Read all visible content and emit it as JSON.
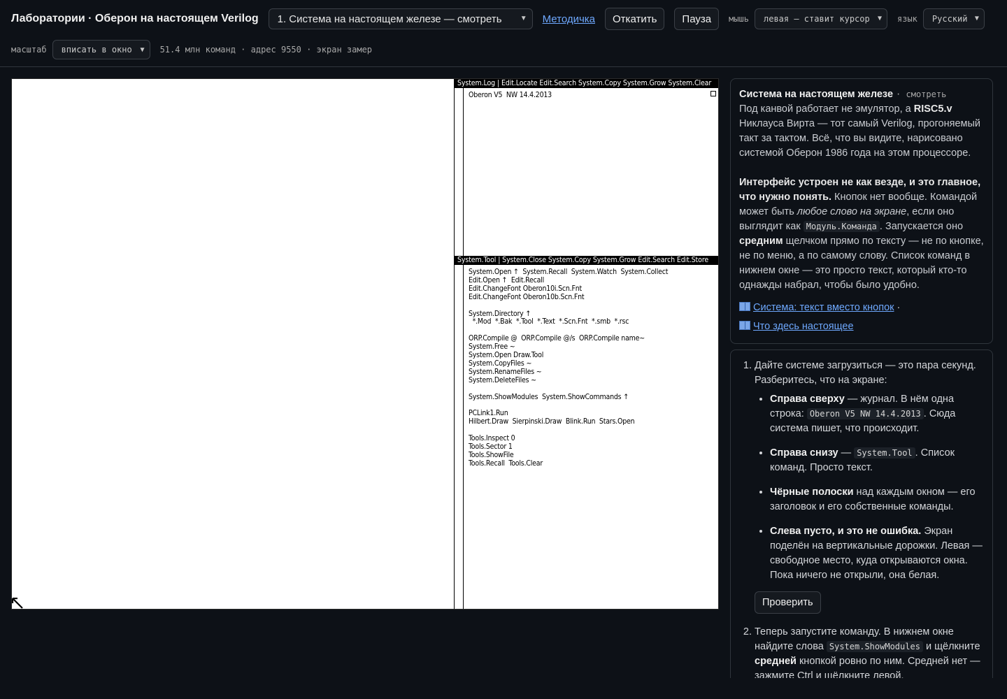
{
  "header": {
    "app_title": "Лаборатории · Оберон на настоящем Verilog",
    "lesson_select": "1. Система на настоящем железе — смотреть",
    "manual_link": "Методичка",
    "rollback_button": "Откатить",
    "pause_button": "Пауза",
    "mouse_label": "мышь",
    "mouse_select": "левая — ставит курсор",
    "lang_label": "язык",
    "lang_select": "Русский",
    "scale_label": "масштаб",
    "scale_select": "вписать в окно",
    "status": "51.4 млн команд · адрес 9550 · экран замер"
  },
  "screen": {
    "log_title": "System.Log | Edit.Locate Edit.Search System.Copy System.Grow System.Clear",
    "log_text": "Oberon V5  NW 14.4.2013",
    "tool_title": "System.Tool | System.Close System.Copy System.Grow Edit.Search Edit.Store",
    "tool_text": "System.Open ↑  System.Recall  System.Watch  System.Collect\nEdit.Open ↑  Edit.Recall\nEdit.ChangeFont Oberon10i.Scn.Fnt\nEdit.ChangeFont Oberon10b.Scn.Fnt\n\nSystem.Directory ↑\n  *.Mod  *.Bak  *.Tool  *.Text  *.Scn.Fnt  *.smb  *.rsc\n\nORP.Compile @  ORP.Compile @/s  ORP.Compile name~\nSystem.Free ~\nSystem.Open Draw.Tool\nSystem.CopyFiles ~\nSystem.RenameFiles ~\nSystem.DeleteFiles ~\n\nSystem.ShowModules  System.ShowCommands ↑\n\nPCLink1.Run\nHilbert.Draw  Sierpinski.Draw  Blink.Run  Stars.Open\n\nTools.Inspect 0\nTools.Sector 1\nTools.ShowFile\nTools.Recall  Tools.Clear"
  },
  "intro": {
    "heading": "Система на настоящем железе",
    "tag": "смотреть",
    "p1_a": "Под канвой работает не эмулятор, а ",
    "p1_b": "RISC5.v",
    "p1_c": " Никлауса Вирта — тот самый Verilog, прогоняемый такт за тактом. Всё, что вы видите, нарисовано системой Оберон 1986 года на этом процессоре.",
    "p2_bold": "Интерфейс устроен не как везде, и это главное, что нужно понять.",
    "p2_a": " Кнопок нет вообще. Командой может быть ",
    "p2_em": "любое слово на экране",
    "p2_b": ", если оно выглядит как ",
    "p2_code": "Модуль.Команда",
    "p2_c": ". Запускается оно ",
    "p2_bold2": "средним",
    "p2_d": " щелчком прямо по тексту — не по кнопке, не по меню, а по самому слову. Список команд в нижнем окне — это просто текст, который кто-то однажды набрал, чтобы было удобно.",
    "link1": "Система: текст вместо кнопок",
    "link_sep": " ·",
    "link2": "Что здесь настоящее"
  },
  "steps": {
    "s1_text": "Дайте системе загрузиться — это пара секунд. Разберитесь, что на экране:",
    "b1_bold": "Справа сверху",
    "b1_a": " — журнал. В нём одна строка: ",
    "b1_code": "Oberon V5 NW 14.4.2013",
    "b1_b": ". Сюда система пишет, что происходит.",
    "b2_bold": "Справа снизу",
    "b2_a": " — ",
    "b2_code": "System.Tool",
    "b2_b": ". Список команд. Просто текст.",
    "b3_bold": "Чёрные полоски",
    "b3_a": " над каждым окном — его заголовок и его собственные команды.",
    "b4_bold": "Слева пусто, и это не ошибка.",
    "b4_a": " Экран поделён на вертикальные дорожки. Левая — свободное место, куда открываются окна. Пока ничего не открыли, она белая.",
    "check_button": "Проверить",
    "s2_a": "Теперь запустите команду. В нижнем окне найдите слова ",
    "s2_code": "System.ShowModules",
    "s2_b": " и щёлкните ",
    "s2_bold": "средней",
    "s2_c": " кнопкой ровно по ним. Средней нет — зажмите Ctrl и щёлкните левой."
  },
  "icons": {
    "select_chevron": "chevron-down-icon",
    "book": "book-icon",
    "cursor": "oberon-arrow-cursor-icon"
  }
}
